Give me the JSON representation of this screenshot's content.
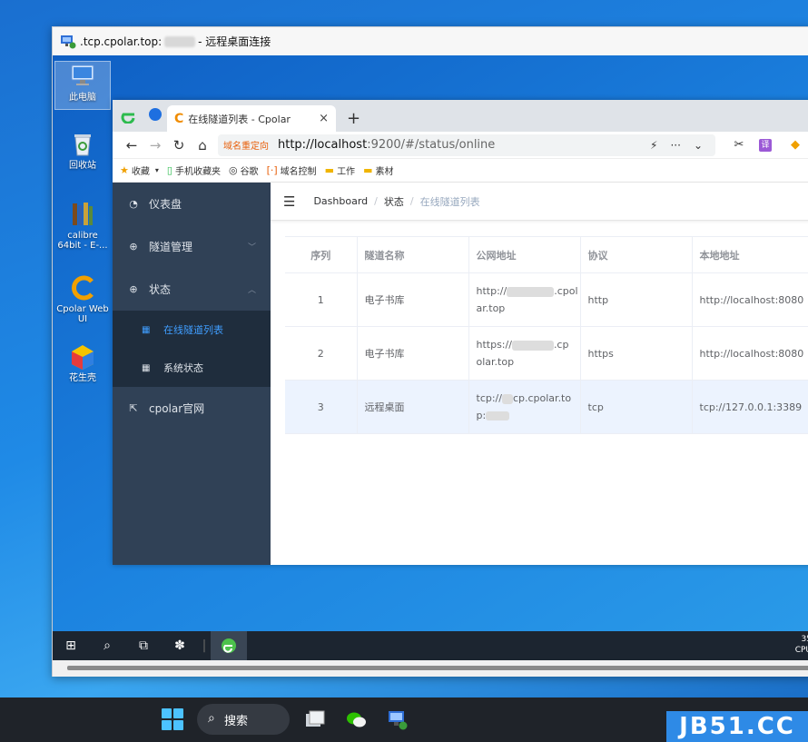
{
  "remote_window": {
    "title_prefix": ".tcp.cpolar.top:",
    "title_suffix": " - 远程桌面连接"
  },
  "desktop_icons": [
    {
      "label": "此电脑",
      "icon": "computer-icon"
    },
    {
      "label": "回收站",
      "icon": "recycle-bin-icon"
    },
    {
      "label": "calibre 64bit - E-...",
      "icon": "calibre-icon"
    },
    {
      "label": "Cpolar Web UI",
      "icon": "cpolar-icon"
    },
    {
      "label": "花生壳",
      "icon": "peanut-shell-icon"
    }
  ],
  "browser": {
    "tab_title": "在线隧道列表 - Cpolar",
    "tab_close": "×",
    "new_tab": "+",
    "address_badge": "域名重定向",
    "url_host": "http://localhost",
    "url_rest": ":9200/#/status/online",
    "bookmarks": [
      {
        "label": "收藏",
        "icon": "star-icon"
      },
      {
        "label": "手机收藏夹",
        "icon": "phone-icon"
      },
      {
        "label": "谷歌",
        "icon": "globe-icon"
      },
      {
        "label": "域名控制",
        "icon": "bracket-icon"
      },
      {
        "label": "工作",
        "icon": "folder-icon"
      },
      {
        "label": "素材",
        "icon": "folder-icon"
      }
    ]
  },
  "sidebar": {
    "items": [
      {
        "label": "仪表盘",
        "icon": "dashboard-icon"
      },
      {
        "label": "隧道管理",
        "icon": "plus-circle-icon"
      },
      {
        "label": "状态",
        "icon": "plus-circle-icon"
      }
    ],
    "sub_items": [
      {
        "label": "在线隧道列表",
        "icon": "grid-icon",
        "active": true
      },
      {
        "label": "系统状态",
        "icon": "grid-icon",
        "active": false
      }
    ],
    "external": {
      "label": "cpolar官网",
      "icon": "external-link-icon"
    }
  },
  "breadcrumb": [
    "Dashboard",
    "状态",
    "在线隧道列表"
  ],
  "table": {
    "headers": [
      "序列",
      "隧道名称",
      "公网地址",
      "协议",
      "本地地址"
    ],
    "rows": [
      {
        "seq": "1",
        "name": "电子书库",
        "public_1": "http://",
        "public_2": ".cpol",
        "public_3": "ar.top",
        "protocol": "http",
        "local": "http://localhost:8080"
      },
      {
        "seq": "2",
        "name": "电子书库",
        "public_1": "https://",
        "public_2": ".cp",
        "public_3": "olar.top",
        "protocol": "https",
        "local": "http://localhost:8080"
      },
      {
        "seq": "3",
        "name": "远程桌面",
        "public_1": "tcp://",
        "public_2": "cp.cpolar.to",
        "public_3": "p:",
        "protocol": "tcp",
        "local": "tcp://127.0.0.1:3389"
      }
    ]
  },
  "remote_tray": {
    "line1": "35",
    "line2": "CPU"
  },
  "local_taskbar": {
    "search_label": "搜索"
  },
  "watermark": "JB51.CC"
}
